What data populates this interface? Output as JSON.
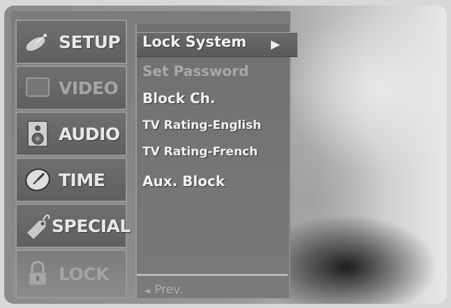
{
  "tabs": [
    {
      "label": "SETUP",
      "icon": "satellite-dish-icon",
      "state": "active"
    },
    {
      "label": "VIDEO",
      "icon": "video-screen-icon",
      "state": "dim"
    },
    {
      "label": "AUDIO",
      "icon": "speaker-icon",
      "state": "normal"
    },
    {
      "label": "TIME",
      "icon": "clock-icon",
      "state": "normal"
    },
    {
      "label": "SPECIAL",
      "icon": "tag-icon",
      "state": "normal"
    },
    {
      "label": "LOCK",
      "icon": "lock-icon",
      "state": "dim"
    }
  ],
  "submenu": {
    "items": [
      {
        "label": "Lock System",
        "selected": true,
        "enabled": true
      },
      {
        "label": "Set Password",
        "selected": false,
        "enabled": false
      },
      {
        "label": "Block Ch.",
        "selected": false,
        "enabled": true
      },
      {
        "label": "TV Rating-English",
        "selected": false,
        "enabled": true
      },
      {
        "label": "TV Rating-French",
        "selected": false,
        "enabled": true
      },
      {
        "label": "Aux. Block",
        "selected": false,
        "enabled": true
      }
    ],
    "arrow": "▶",
    "prev_label": "Prev.",
    "prev_glyph": "◄"
  }
}
